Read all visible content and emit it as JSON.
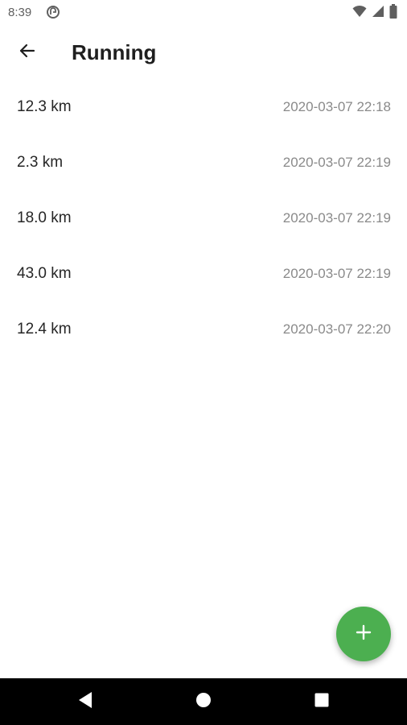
{
  "status_bar": {
    "time": "8:39",
    "icons": [
      "notification-icon",
      "wifi-icon",
      "signal-icon",
      "battery-icon"
    ]
  },
  "app_bar": {
    "title": "Running",
    "back_icon": "arrow-back-icon"
  },
  "entries": [
    {
      "distance": "12.3 km",
      "date": "2020-03-07 22:18"
    },
    {
      "distance": "2.3 km",
      "date": "2020-03-07 22:19"
    },
    {
      "distance": "18.0 km",
      "date": "2020-03-07 22:19"
    },
    {
      "distance": "43.0 km",
      "date": "2020-03-07 22:19"
    },
    {
      "distance": "12.4 km",
      "date": "2020-03-07 22:20"
    }
  ],
  "fab": {
    "icon": "add-icon",
    "color": "#4caf50"
  },
  "nav_bar": {
    "icons": [
      "back-triangle-icon",
      "home-circle-icon",
      "recents-square-icon"
    ]
  }
}
